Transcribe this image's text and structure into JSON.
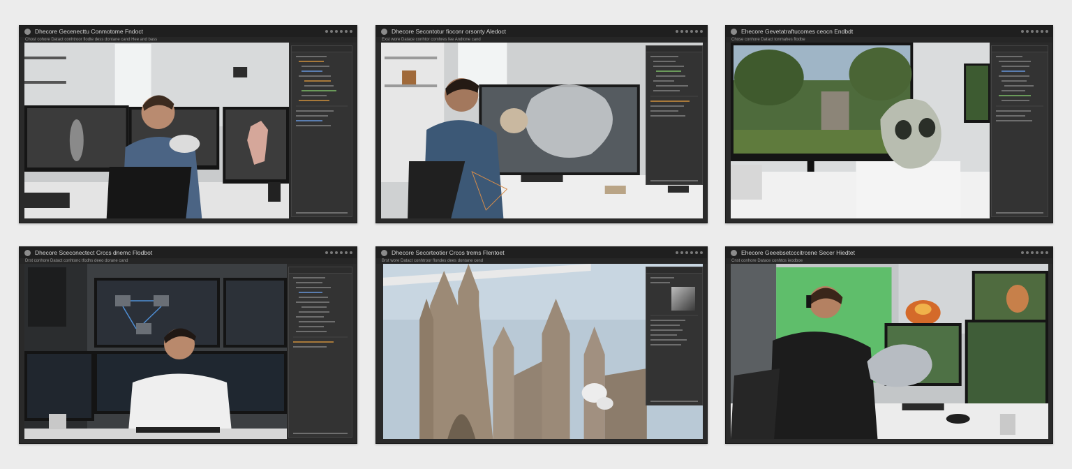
{
  "windows": [
    {
      "title": "Dhecore Gecenecttu Conmotome Fndoct",
      "menu": "Chost cohore Datact conhtroor flodte dess dontane cand Hee and bass"
    },
    {
      "title": "Dhecore Secontotur fioconr orsonty Aledoct",
      "menu": "Exst wore Datace conhtor comhres fee Andtone cand"
    },
    {
      "title": "Ehecore Gevetatraftucomes ceocn Endbdt",
      "menu": "Chose conhore Datact tonmahes flodbe"
    },
    {
      "title": "Dhecore Sceconectect Crccs dnemc Flodbot",
      "menu": "Drst conhore Datact conhtonc tfodhs deeo dorane cand"
    },
    {
      "title": "Dhecore Secorteotier Crcos trems Flentoet",
      "menu": "Brst wore Datact conhtroor flondes dees dontane cend"
    },
    {
      "title": "Ehecore Geeebsetcccitrcene Secer Hiedtet",
      "menu": "Cnst conhore Datace conhtos ieodboe"
    }
  ]
}
